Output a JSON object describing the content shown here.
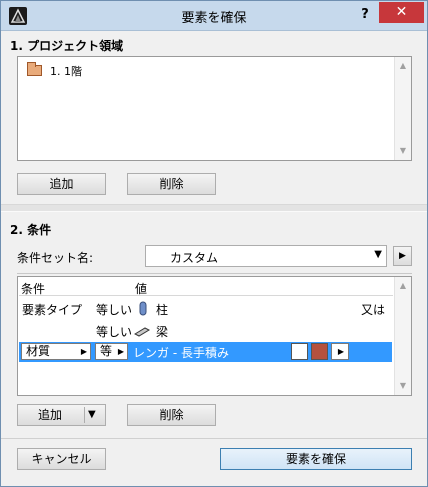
{
  "window": {
    "title": "要素を確保",
    "help_label": "?",
    "close_label": "✕"
  },
  "section1": {
    "heading": "1. プロジェクト領域",
    "items": [
      {
        "label": "1. 1階",
        "icon": "folder-icon"
      }
    ],
    "add_label": "追加",
    "delete_label": "削除"
  },
  "section2": {
    "heading": "2. 条件",
    "criteria_set_label": "条件セット名:",
    "criteria_set_value": "カスタム",
    "columns": {
      "condition": "条件",
      "value": "値"
    },
    "rows": [
      {
        "condition": "要素タイプ",
        "operator": "等しい",
        "icon": "column-icon",
        "value": "柱",
        "conjunction": "又は"
      },
      {
        "condition": "",
        "operator": "等しい",
        "icon": "beam-icon",
        "value": "梁",
        "conjunction": ""
      },
      {
        "condition": "材質",
        "operator": "等",
        "icon": "",
        "value": "レンガ - 長手積み",
        "conjunction": "",
        "selected": true,
        "swatch_colors": [
          "#ffffff",
          "#b5513e"
        ]
      }
    ],
    "add_label": "追加",
    "delete_label": "削除"
  },
  "footer": {
    "cancel_label": "キャンセル",
    "confirm_label": "要素を確保"
  },
  "colors": {
    "selection": "#3399ff",
    "close": "#c7373b",
    "titlebar": "#c6d9ec"
  }
}
